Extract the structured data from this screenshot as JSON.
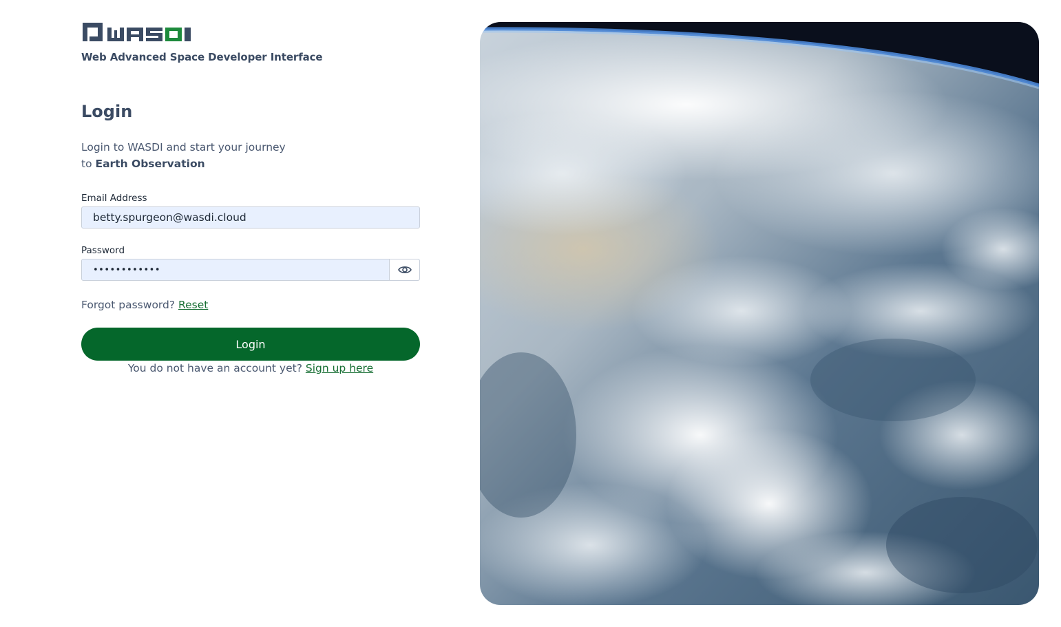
{
  "brand": {
    "logo_text": "WASDI",
    "tagline": "Web Advanced Space Developer Interface"
  },
  "login": {
    "title": "Login",
    "intro_line1": "Login to WASDI and start your journey",
    "intro_line2_prefix": "to ",
    "intro_line2_bold": "Earth Observation",
    "email_label": "Email Address",
    "email_value": "betty.spurgeon@wasdi.cloud",
    "password_label": "Password",
    "password_value": "••••••••••••",
    "password_toggle_icon": "eye-icon",
    "forgot_text": "Forgot password? ",
    "reset_link": "Reset",
    "login_button": "Login",
    "signup_text": "You do not have an account yet? ",
    "signup_link": "Sign up here"
  },
  "colors": {
    "primary_green": "#05672b",
    "link_green": "#186f34",
    "text_dark": "#3b4b63",
    "input_bg": "#e8f0fe"
  },
  "hero_image": {
    "subject": "earth-from-orbit"
  }
}
